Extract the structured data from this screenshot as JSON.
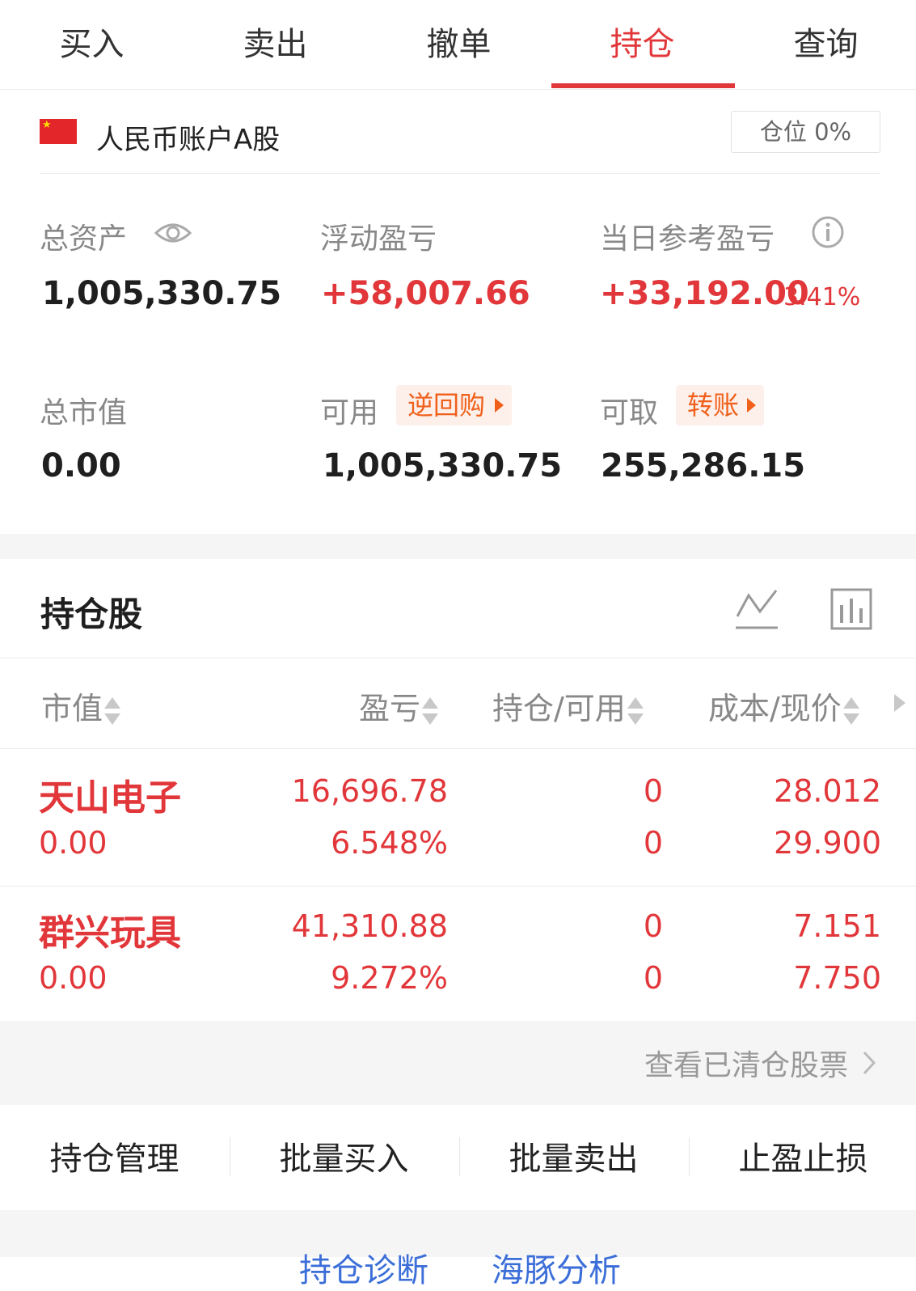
{
  "tabs": [
    {
      "label": "买入"
    },
    {
      "label": "卖出"
    },
    {
      "label": "撤单"
    },
    {
      "label": "持仓",
      "active": true
    },
    {
      "label": "查询"
    }
  ],
  "account": {
    "name": "人民币账户A股",
    "position_ratio": "仓位 0%"
  },
  "summary": {
    "total_assets_label": "总资产",
    "total_assets": "1,005,330.75",
    "floating_pl_label": "浮动盈亏",
    "floating_pl": "+58,007.66",
    "daily_pl_label": "当日参考盈亏",
    "daily_pl": "+33,192.00",
    "daily_pl_pct": "3.41%",
    "market_value_label": "总市值",
    "market_value": "0.00",
    "available_label": "可用",
    "available": "1,005,330.75",
    "reverse_repo_label": "逆回购",
    "withdrawable_label": "可取",
    "withdrawable": "255,286.15",
    "transfer_label": "转账"
  },
  "holdings": {
    "title": "持仓股",
    "columns": [
      "市值",
      "盈亏",
      "持仓/可用",
      "成本/现价"
    ],
    "rows": [
      {
        "name": "天山电子",
        "market_value": "0.00",
        "pl": "16,696.78",
        "pl_pct": "6.548%",
        "position": "0",
        "available": "0",
        "cost": "28.012",
        "price": "29.900"
      },
      {
        "name": "群兴玩具",
        "market_value": "0.00",
        "pl": "41,310.88",
        "pl_pct": "9.272%",
        "position": "0",
        "available": "0",
        "cost": "7.151",
        "price": "7.750"
      }
    ],
    "cleared_link": "查看已清仓股票"
  },
  "actions": [
    "持仓管理",
    "批量买入",
    "批量卖出",
    "止盈止损"
  ],
  "bottom_links": [
    "持仓诊断",
    "海豚分析"
  ],
  "colors": {
    "accent": "#e2373a",
    "orange": "#f0601b",
    "link": "#3b6ed8"
  }
}
